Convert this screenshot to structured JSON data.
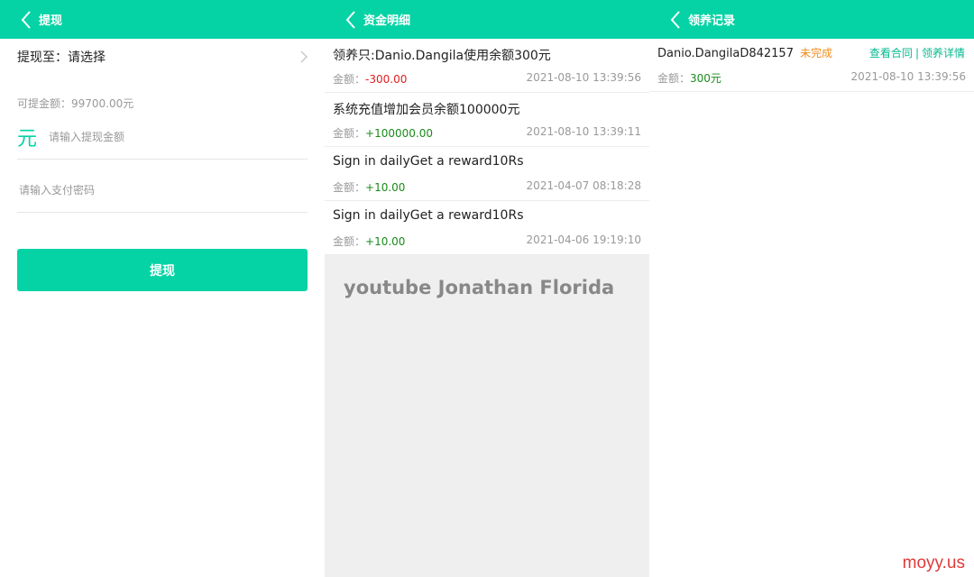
{
  "colors": {
    "accent": "#06d3a5",
    "negative": "#e02020",
    "positive": "#1a8a1a",
    "pending": "#f08c1a"
  },
  "withdraw": {
    "title": "提现",
    "to_label": "提现至：请选择",
    "available": "可提金额：99700.00元",
    "currency_symbol": "元",
    "amount_placeholder": "请输入提现金额",
    "password_placeholder": "请输入支付密码",
    "submit_label": "提现"
  },
  "funds": {
    "title": "资金明细",
    "amount_label": "金额：",
    "items": [
      {
        "title": "领养只:Danio.Dangila使用余额300元",
        "amount": "-300.00",
        "sign": "negative",
        "time": "2021-08-10 13:39:56"
      },
      {
        "title": "系统充值增加会员余额100000元",
        "amount": "+100000.00",
        "sign": "positive",
        "time": "2021-08-10 13:39:11"
      },
      {
        "title": "Sign in dailyGet a reward10Rs",
        "amount": "+10.00",
        "sign": "positive",
        "time": "2021-04-07 08:18:28"
      },
      {
        "title": "Sign in dailyGet a reward10Rs",
        "amount": "+10.00",
        "sign": "positive",
        "time": "2021-04-06 19:19:10"
      }
    ],
    "watermark": "youtube Jonathan Florida"
  },
  "records": {
    "title": "领养记录",
    "amount_label": "金额：",
    "items": [
      {
        "name": "Danio.DangilaD842157",
        "status": "未完成",
        "link_contract": "查看合同",
        "separator": "|",
        "link_details": "领养详情",
        "amount": "300元",
        "time": "2021-08-10 13:39:56"
      }
    ]
  },
  "site_watermark": "moyy.us"
}
